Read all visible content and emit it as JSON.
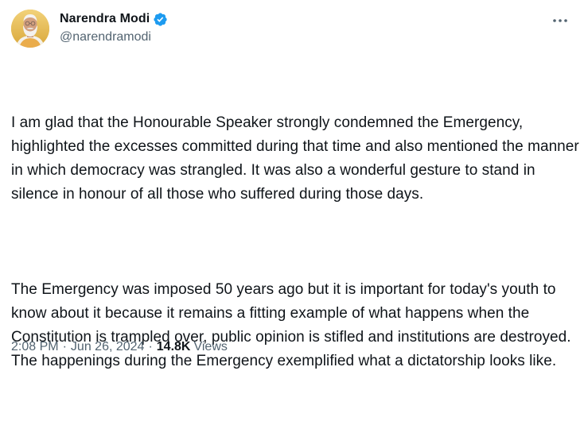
{
  "author": {
    "display_name": "Narendra Modi",
    "handle": "@narendramodi",
    "verified": true,
    "verified_color": "#1d9bf0",
    "avatar": "profile-photo"
  },
  "more_menu": {
    "icon": "more-horizontal-icon"
  },
  "tweet": {
    "paragraphs": [
      "I am glad that the Honourable Speaker strongly condemned the Emergency, highlighted the excesses committed during that time and also mentioned the manner in which democracy was strangled. It was also a wonderful gesture to stand in silence in honour of all those who suffered during those days.",
      "The Emergency was imposed 50 years ago but it is important for today's youth to know about it because it remains a fitting example of what happens when the Constitution is trampled over, public opinion is stifled and institutions are destroyed. The happenings during the Emergency exemplified what a dictatorship looks like."
    ]
  },
  "meta": {
    "time": "2:08 PM",
    "separator": "·",
    "date": "Jun 26, 2024",
    "views_count": "14.8K",
    "views_label": "Views"
  },
  "colors": {
    "text_primary": "#0f1419",
    "text_secondary": "#536471",
    "background": "#ffffff"
  }
}
